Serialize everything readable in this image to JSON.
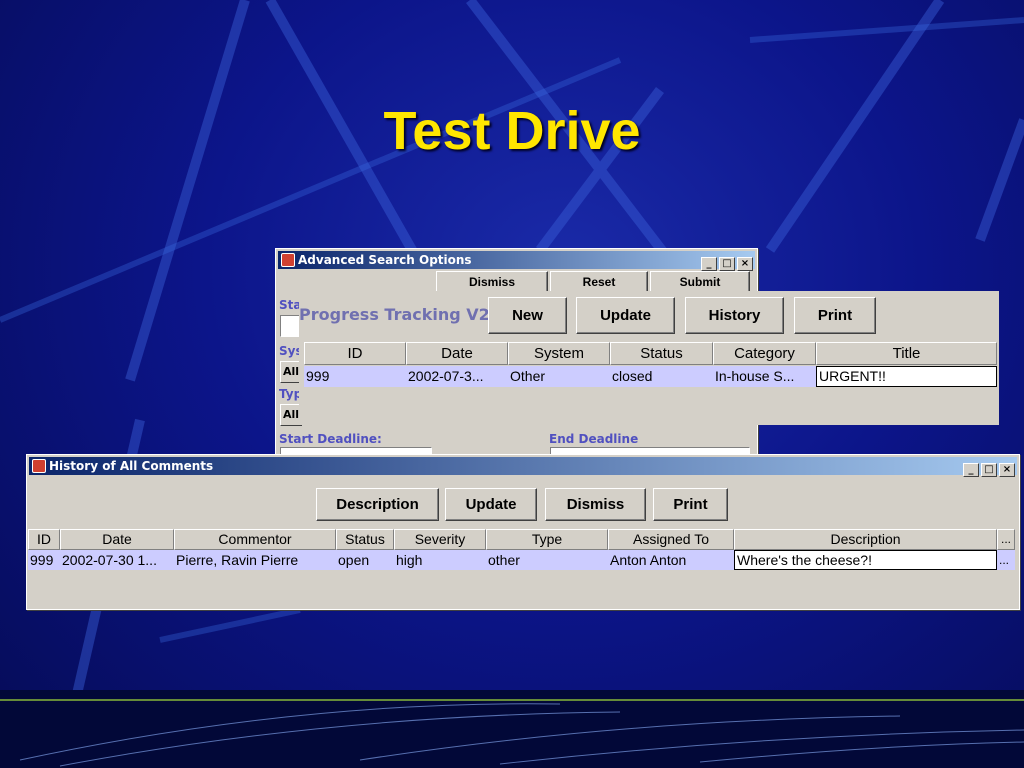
{
  "slide": {
    "title": "Test Drive"
  },
  "colors": {
    "title": "#ffe600",
    "selected_row": "#ccccff",
    "titlebar": "#0a246a",
    "label": "#5050c0"
  },
  "advanced_search": {
    "title": "Advanced Search Options",
    "buttons": {
      "dismiss": "Dismiss",
      "reset": "Reset",
      "submit": "Submit"
    },
    "labels": {
      "status": "Sta",
      "system": "Sys",
      "type": "Typ",
      "start_deadline": "Start Deadline:",
      "end_deadline": "End Deadline"
    },
    "system_value": "All",
    "type_value": "All"
  },
  "progress": {
    "app_title": "Progress Tracking V2.0",
    "buttons": {
      "new": "New",
      "update": "Update",
      "history": "History",
      "print": "Print"
    },
    "columns": [
      "ID",
      "Date",
      "System",
      "Status",
      "Category",
      "Title"
    ],
    "rows": [
      [
        "999",
        "2002-07-3...",
        "Other",
        "closed",
        "In-house S...",
        "URGENT!!"
      ]
    ]
  },
  "history": {
    "title": "History of All Comments",
    "buttons": {
      "description": "Description",
      "update": "Update",
      "dismiss": "Dismiss",
      "print": "Print"
    },
    "columns": [
      "ID",
      "Date",
      "Commentor",
      "Status",
      "Severity",
      "Type",
      "Assigned To",
      "Description",
      "..."
    ],
    "rows": [
      [
        "999",
        "2002-07-30 1...",
        "Pierre, Ravin Pierre",
        "open",
        "high",
        "other",
        "Anton Anton",
        "Where's the cheese?!",
        "..."
      ]
    ]
  },
  "window_controls": {
    "minimize": "_",
    "maximize": "□",
    "close": "×"
  }
}
